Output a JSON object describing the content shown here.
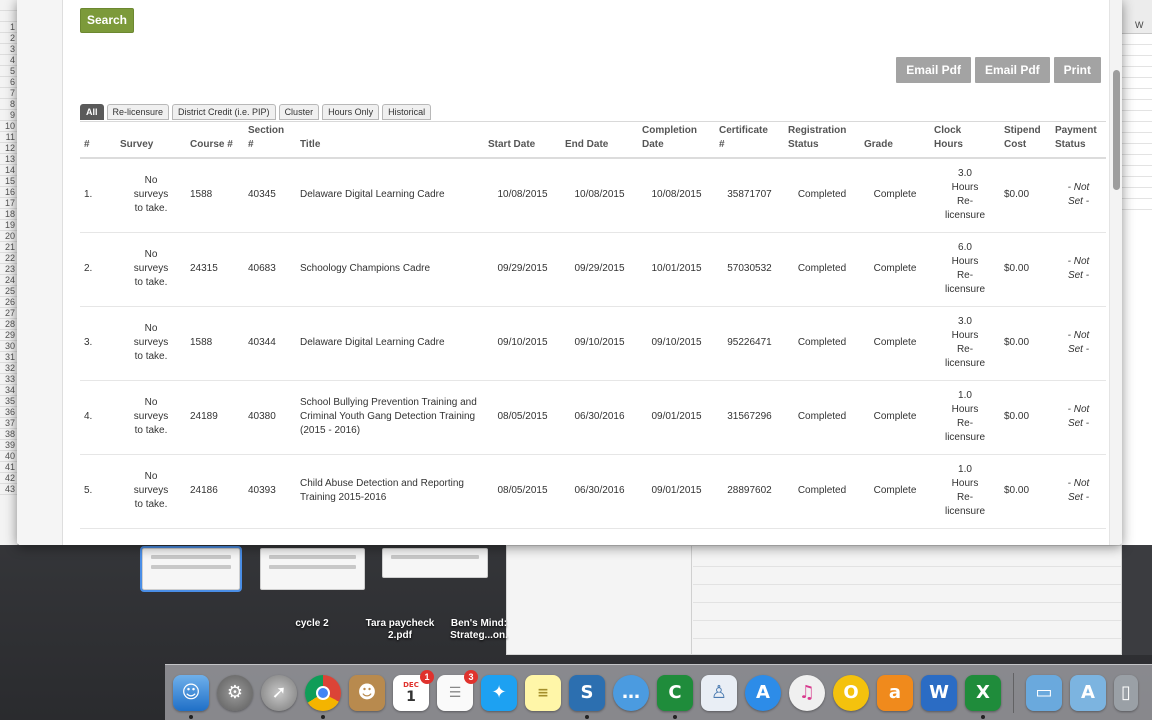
{
  "spreadsheet": {
    "row_numbers": [
      "",
      "",
      "1",
      "2",
      "3",
      "4",
      "5",
      "6",
      "7",
      "8",
      "9",
      "10",
      "11",
      "12",
      "13",
      "14",
      "15",
      "16",
      "17",
      "18",
      "19",
      "20",
      "21",
      "22",
      "23",
      "24",
      "25",
      "26",
      "27",
      "28",
      "29",
      "30",
      "31",
      "32",
      "33",
      "34",
      "35",
      "36",
      "37",
      "38",
      "39",
      "40",
      "41",
      "42",
      "43"
    ],
    "column_label": "W"
  },
  "search": {
    "button_label": "Search"
  },
  "actions": [
    {
      "label": "Email Pdf"
    },
    {
      "label": "Email Pdf"
    },
    {
      "label": "Print"
    }
  ],
  "tabs": [
    {
      "label": "All",
      "active": true
    },
    {
      "label": "Re-licensure",
      "active": false
    },
    {
      "label": "District Credit (i.e. PIP)",
      "active": false
    },
    {
      "label": "Cluster",
      "active": false
    },
    {
      "label": "Hours Only",
      "active": false
    },
    {
      "label": "Historical",
      "active": false
    }
  ],
  "table": {
    "headers": {
      "num": "#",
      "survey": "Survey",
      "course": "Course #",
      "section_l1": "Section",
      "section_l2": "#",
      "title": "Title",
      "start": "Start Date",
      "end": "End Date",
      "completion_l1": "Completion",
      "completion_l2": "Date",
      "certificate_l1": "Certificate",
      "certificate_l2": "#",
      "registration_l1": "Registration",
      "registration_l2": "Status",
      "grade": "Grade",
      "clock_l1": "Clock",
      "clock_l2": "Hours",
      "stipend_l1": "Stipend",
      "stipend_l2": "Cost",
      "payment_l1": "Payment",
      "payment_l2": "Status"
    },
    "rows": [
      {
        "num": "1.",
        "survey": "No surveys to take.",
        "course": "1588",
        "section": "40345",
        "title": "Delaware Digital Learning Cadre",
        "start": "10/08/2015",
        "end": "10/08/2015",
        "completion": "10/08/2015",
        "certificate": "35871707",
        "registration": "Completed",
        "grade": "Complete",
        "clock": "3.0 Hours Re-licensure",
        "stipend": "$0.00",
        "payment": "- Not Set -"
      },
      {
        "num": "2.",
        "survey": "No surveys to take.",
        "course": "24315",
        "section": "40683",
        "title": "Schoology Champions Cadre",
        "start": "09/29/2015",
        "end": "09/29/2015",
        "completion": "10/01/2015",
        "certificate": "57030532",
        "registration": "Completed",
        "grade": "Complete",
        "clock": "6.0 Hours Re-licensure",
        "stipend": "$0.00",
        "payment": "- Not Set -"
      },
      {
        "num": "3.",
        "survey": "No surveys to take.",
        "course": "1588",
        "section": "40344",
        "title": "Delaware Digital Learning Cadre",
        "start": "09/10/2015",
        "end": "09/10/2015",
        "completion": "09/10/2015",
        "certificate": "95226471",
        "registration": "Completed",
        "grade": "Complete",
        "clock": "3.0 Hours Re-licensure",
        "stipend": "$0.00",
        "payment": "- Not Set -"
      },
      {
        "num": "4.",
        "survey": "No surveys to take.",
        "course": "24189",
        "section": "40380",
        "title": "School Bullying Prevention Training and Criminal Youth Gang Detection Training (2015 - 2016)",
        "start": "08/05/2015",
        "end": "06/30/2016",
        "completion": "09/01/2015",
        "certificate": "31567296",
        "registration": "Completed",
        "grade": "Complete",
        "clock": "1.0 Hours Re-licensure",
        "stipend": "$0.00",
        "payment": "- Not Set -"
      },
      {
        "num": "5.",
        "survey": "No surveys to take.",
        "course": "24186",
        "section": "40393",
        "title": "Child Abuse Detection and Reporting Training 2015-2016",
        "start": "08/05/2015",
        "end": "06/30/2016",
        "completion": "09/01/2015",
        "certificate": "28897602",
        "registration": "Completed",
        "grade": "Complete",
        "clock": "1.0 Hours Re-licensure",
        "stipend": "$0.00",
        "payment": "- Not Set -"
      }
    ]
  },
  "desktop": {
    "labels": [
      "cycle 2",
      "Tara paycheck 2.pdf",
      "Ben's Mind: Strateg...on."
    ]
  },
  "dock": {
    "calendar_month": "DEC",
    "calendar_day": "1",
    "calendar_badge": "1",
    "reminders_badge": "3"
  },
  "colors": {
    "search_button": "#7c9a3a",
    "action_button": "#a3a3a3",
    "link": "#2a6fb5",
    "active_tab": "#5a5a5a"
  }
}
